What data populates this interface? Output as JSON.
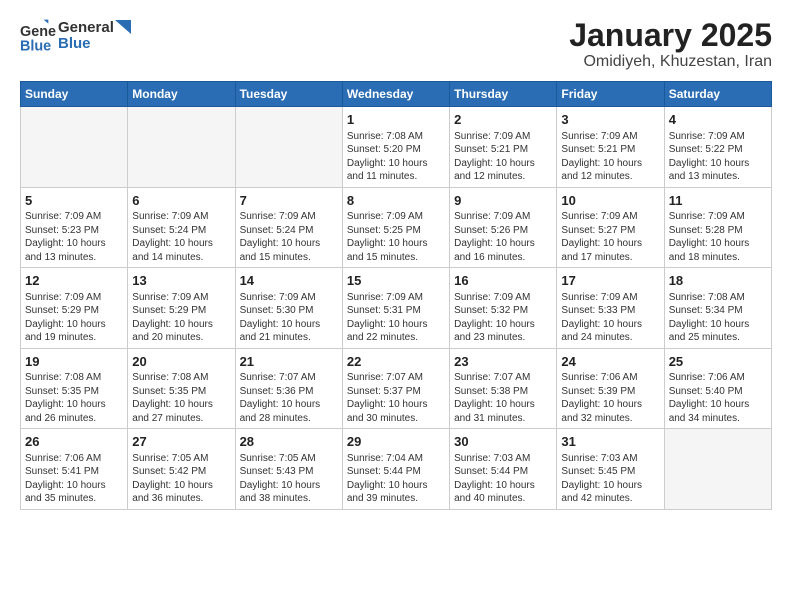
{
  "header": {
    "logo_general": "General",
    "logo_blue": "Blue",
    "title": "January 2025",
    "subtitle": "Omidiyeh, Khuzestan, Iran"
  },
  "weekdays": [
    "Sunday",
    "Monday",
    "Tuesday",
    "Wednesday",
    "Thursday",
    "Friday",
    "Saturday"
  ],
  "weeks": [
    [
      {
        "day": "",
        "info": ""
      },
      {
        "day": "",
        "info": ""
      },
      {
        "day": "",
        "info": ""
      },
      {
        "day": "1",
        "info": "Sunrise: 7:08 AM\nSunset: 5:20 PM\nDaylight: 10 hours\nand 11 minutes."
      },
      {
        "day": "2",
        "info": "Sunrise: 7:09 AM\nSunset: 5:21 PM\nDaylight: 10 hours\nand 12 minutes."
      },
      {
        "day": "3",
        "info": "Sunrise: 7:09 AM\nSunset: 5:21 PM\nDaylight: 10 hours\nand 12 minutes."
      },
      {
        "day": "4",
        "info": "Sunrise: 7:09 AM\nSunset: 5:22 PM\nDaylight: 10 hours\nand 13 minutes."
      }
    ],
    [
      {
        "day": "5",
        "info": "Sunrise: 7:09 AM\nSunset: 5:23 PM\nDaylight: 10 hours\nand 13 minutes."
      },
      {
        "day": "6",
        "info": "Sunrise: 7:09 AM\nSunset: 5:24 PM\nDaylight: 10 hours\nand 14 minutes."
      },
      {
        "day": "7",
        "info": "Sunrise: 7:09 AM\nSunset: 5:24 PM\nDaylight: 10 hours\nand 15 minutes."
      },
      {
        "day": "8",
        "info": "Sunrise: 7:09 AM\nSunset: 5:25 PM\nDaylight: 10 hours\nand 15 minutes."
      },
      {
        "day": "9",
        "info": "Sunrise: 7:09 AM\nSunset: 5:26 PM\nDaylight: 10 hours\nand 16 minutes."
      },
      {
        "day": "10",
        "info": "Sunrise: 7:09 AM\nSunset: 5:27 PM\nDaylight: 10 hours\nand 17 minutes."
      },
      {
        "day": "11",
        "info": "Sunrise: 7:09 AM\nSunset: 5:28 PM\nDaylight: 10 hours\nand 18 minutes."
      }
    ],
    [
      {
        "day": "12",
        "info": "Sunrise: 7:09 AM\nSunset: 5:29 PM\nDaylight: 10 hours\nand 19 minutes."
      },
      {
        "day": "13",
        "info": "Sunrise: 7:09 AM\nSunset: 5:29 PM\nDaylight: 10 hours\nand 20 minutes."
      },
      {
        "day": "14",
        "info": "Sunrise: 7:09 AM\nSunset: 5:30 PM\nDaylight: 10 hours\nand 21 minutes."
      },
      {
        "day": "15",
        "info": "Sunrise: 7:09 AM\nSunset: 5:31 PM\nDaylight: 10 hours\nand 22 minutes."
      },
      {
        "day": "16",
        "info": "Sunrise: 7:09 AM\nSunset: 5:32 PM\nDaylight: 10 hours\nand 23 minutes."
      },
      {
        "day": "17",
        "info": "Sunrise: 7:09 AM\nSunset: 5:33 PM\nDaylight: 10 hours\nand 24 minutes."
      },
      {
        "day": "18",
        "info": "Sunrise: 7:08 AM\nSunset: 5:34 PM\nDaylight: 10 hours\nand 25 minutes."
      }
    ],
    [
      {
        "day": "19",
        "info": "Sunrise: 7:08 AM\nSunset: 5:35 PM\nDaylight: 10 hours\nand 26 minutes."
      },
      {
        "day": "20",
        "info": "Sunrise: 7:08 AM\nSunset: 5:35 PM\nDaylight: 10 hours\nand 27 minutes."
      },
      {
        "day": "21",
        "info": "Sunrise: 7:07 AM\nSunset: 5:36 PM\nDaylight: 10 hours\nand 28 minutes."
      },
      {
        "day": "22",
        "info": "Sunrise: 7:07 AM\nSunset: 5:37 PM\nDaylight: 10 hours\nand 30 minutes."
      },
      {
        "day": "23",
        "info": "Sunrise: 7:07 AM\nSunset: 5:38 PM\nDaylight: 10 hours\nand 31 minutes."
      },
      {
        "day": "24",
        "info": "Sunrise: 7:06 AM\nSunset: 5:39 PM\nDaylight: 10 hours\nand 32 minutes."
      },
      {
        "day": "25",
        "info": "Sunrise: 7:06 AM\nSunset: 5:40 PM\nDaylight: 10 hours\nand 34 minutes."
      }
    ],
    [
      {
        "day": "26",
        "info": "Sunrise: 7:06 AM\nSunset: 5:41 PM\nDaylight: 10 hours\nand 35 minutes."
      },
      {
        "day": "27",
        "info": "Sunrise: 7:05 AM\nSunset: 5:42 PM\nDaylight: 10 hours\nand 36 minutes."
      },
      {
        "day": "28",
        "info": "Sunrise: 7:05 AM\nSunset: 5:43 PM\nDaylight: 10 hours\nand 38 minutes."
      },
      {
        "day": "29",
        "info": "Sunrise: 7:04 AM\nSunset: 5:44 PM\nDaylight: 10 hours\nand 39 minutes."
      },
      {
        "day": "30",
        "info": "Sunrise: 7:03 AM\nSunset: 5:44 PM\nDaylight: 10 hours\nand 40 minutes."
      },
      {
        "day": "31",
        "info": "Sunrise: 7:03 AM\nSunset: 5:45 PM\nDaylight: 10 hours\nand 42 minutes."
      },
      {
        "day": "",
        "info": ""
      }
    ]
  ]
}
